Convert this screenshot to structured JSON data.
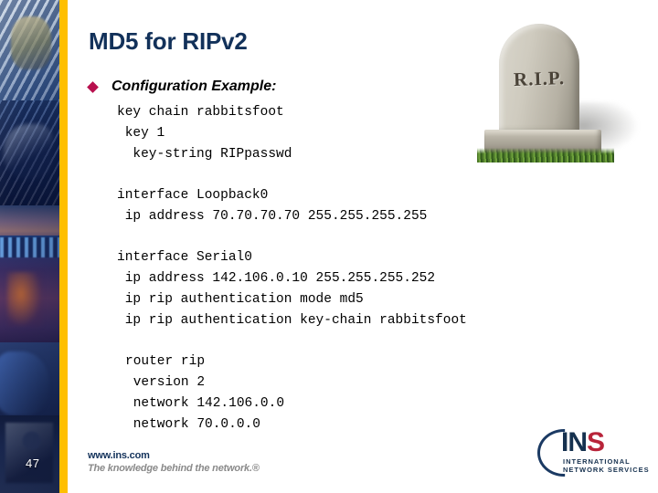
{
  "slide": {
    "title": "MD5 for RIPv2",
    "page_number": "47",
    "accent_color": "#ffbf00",
    "title_color": "#12315a",
    "bullet_color": "#b8104e"
  },
  "bullet": {
    "label": "Configuration Example:",
    "marker": "diamond-bullet"
  },
  "code_blocks": [
    {
      "indented": false,
      "lines": [
        "key chain rabbitsfoot",
        " key 1",
        "  key-string RIPpasswd"
      ]
    },
    {
      "indented": false,
      "lines": [
        "interface Loopback0",
        " ip address 70.70.70.70 255.255.255.255"
      ]
    },
    {
      "indented": false,
      "lines": [
        "interface Serial0",
        " ip address 142.106.0.10 255.255.255.252",
        " ip rip authentication mode md5",
        " ip rip authentication key-chain rabbitsfoot"
      ]
    },
    {
      "indented": true,
      "lines": [
        "router rip",
        " version 2",
        " network 142.106.0.0",
        " network 70.0.0.0"
      ]
    }
  ],
  "tombstone": {
    "inscription": "R.I.P."
  },
  "footer": {
    "url": "www.ins.com",
    "tagline": "The knowledge behind the network.®"
  },
  "logo": {
    "word_in": "IN",
    "word_s": "S",
    "line1": "INTERNATIONAL",
    "line2": "NETWORK SERVICES"
  }
}
